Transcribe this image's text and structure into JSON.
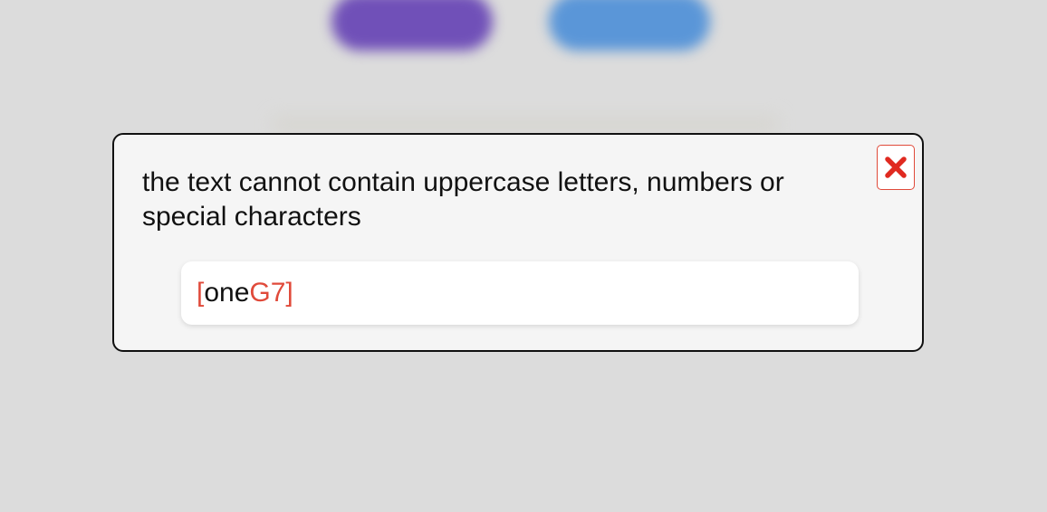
{
  "modal": {
    "message": "the text cannot contain uppercase letters, numbers or special characters",
    "close_icon": "close-x-icon",
    "value_segments": [
      {
        "text": "[",
        "valid": false
      },
      {
        "text": "one",
        "valid": true
      },
      {
        "text": "G7]",
        "valid": false
      }
    ]
  },
  "colors": {
    "invalid": "#e04a3a",
    "valid": "#111111",
    "modal_bg": "#f5f5f5",
    "backdrop": "#dcdcdc",
    "bg_button_purple": "#7050b8",
    "bg_button_blue": "#5a96d8"
  }
}
